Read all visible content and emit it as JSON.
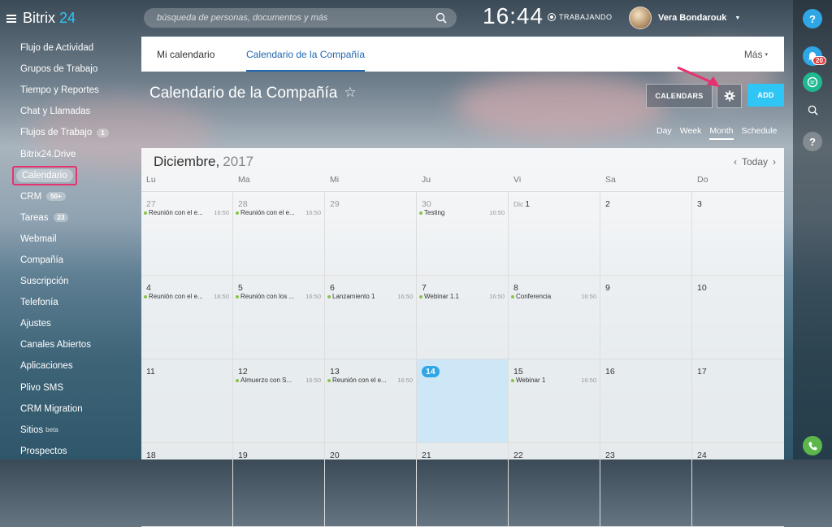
{
  "header": {
    "brand": "Bitrix",
    "brand_number": "24",
    "search_placeholder": "búsqueda de personas, documentos y más",
    "clock": "16:44",
    "status": "TRABAJANDO",
    "user_name": "Vera Bondarouk"
  },
  "sidebar": {
    "items": [
      {
        "label": "Flujo de Actividad"
      },
      {
        "label": "Grupos de Trabajo"
      },
      {
        "label": "Tiempo y Reportes"
      },
      {
        "label": "Chat y Llamadas"
      },
      {
        "label": "Flujos de Trabajo",
        "badge": "1"
      },
      {
        "label": "Bitrix24.Drive"
      },
      {
        "label": "Calendario",
        "active": true
      },
      {
        "label": "CRM",
        "badge": "50+"
      },
      {
        "label": "Tareas",
        "badge": "23"
      },
      {
        "label": "Webmail"
      },
      {
        "label": "Compañía"
      },
      {
        "label": "Suscripción"
      },
      {
        "label": "Telefonía"
      },
      {
        "label": "Ajustes"
      },
      {
        "label": "Canales Abiertos"
      },
      {
        "label": "Aplicaciones"
      },
      {
        "label": "Plivo SMS"
      },
      {
        "label": "CRM Migration"
      },
      {
        "label": "Sitios",
        "sup": "beta"
      },
      {
        "label": "Prospectos"
      }
    ]
  },
  "rail": {
    "help": "?",
    "notifications_count": "20"
  },
  "tabs": {
    "my_calendar": "Mi calendario",
    "company_calendar": "Calendario de la Compañía",
    "more": "Más"
  },
  "page": {
    "title": "Calendario de la Compañía",
    "star": "☆",
    "calendars_button": "CALENDARS",
    "add_button": "ADD",
    "views": [
      "Day",
      "Week",
      "Month",
      "Schedule"
    ],
    "active_view": "Month"
  },
  "calendar": {
    "month": "Diciembre,",
    "year": "2017",
    "today_label": "Today",
    "weekdays": [
      "Lu",
      "Ma",
      "Mi",
      "Ju",
      "Vi",
      "Sa",
      "Do"
    ],
    "weeks": [
      [
        {
          "num": "27",
          "other": true,
          "event": {
            "title": "Reunión con el e...",
            "time": "16:50"
          }
        },
        {
          "num": "28",
          "other": true,
          "event": {
            "title": "Reunión con el e...",
            "time": "16:50"
          }
        },
        {
          "num": "29",
          "other": true
        },
        {
          "num": "30",
          "other": true,
          "event": {
            "title": "Testing",
            "time": "16:50"
          }
        },
        {
          "num": "1",
          "pre": "Dic"
        },
        {
          "num": "2"
        },
        {
          "num": "3"
        }
      ],
      [
        {
          "num": "4",
          "event": {
            "title": "Reunión con el e...",
            "time": "16:50"
          }
        },
        {
          "num": "5",
          "event": {
            "title": "Reunión con los ...",
            "time": "16:50"
          }
        },
        {
          "num": "6",
          "event": {
            "title": "Lanzamiento 1",
            "time": "16:50"
          }
        },
        {
          "num": "7",
          "event": {
            "title": "Webinar 1.1",
            "time": "16:50"
          }
        },
        {
          "num": "8",
          "event": {
            "title": "Conferencia",
            "time": "16:50"
          }
        },
        {
          "num": "9"
        },
        {
          "num": "10"
        }
      ],
      [
        {
          "num": "11"
        },
        {
          "num": "12",
          "event": {
            "title": "Almuerzo con S...",
            "time": "16:50"
          }
        },
        {
          "num": "13",
          "event": {
            "title": "Reunión con el e...",
            "time": "16:50"
          }
        },
        {
          "num": "14",
          "today": true
        },
        {
          "num": "15",
          "event": {
            "title": "Webinar 1",
            "time": "16:50"
          }
        },
        {
          "num": "16"
        },
        {
          "num": "17"
        }
      ],
      [
        {
          "num": "18"
        },
        {
          "num": "19"
        },
        {
          "num": "20"
        },
        {
          "num": "21"
        },
        {
          "num": "22"
        },
        {
          "num": "23"
        },
        {
          "num": "24"
        }
      ]
    ]
  }
}
